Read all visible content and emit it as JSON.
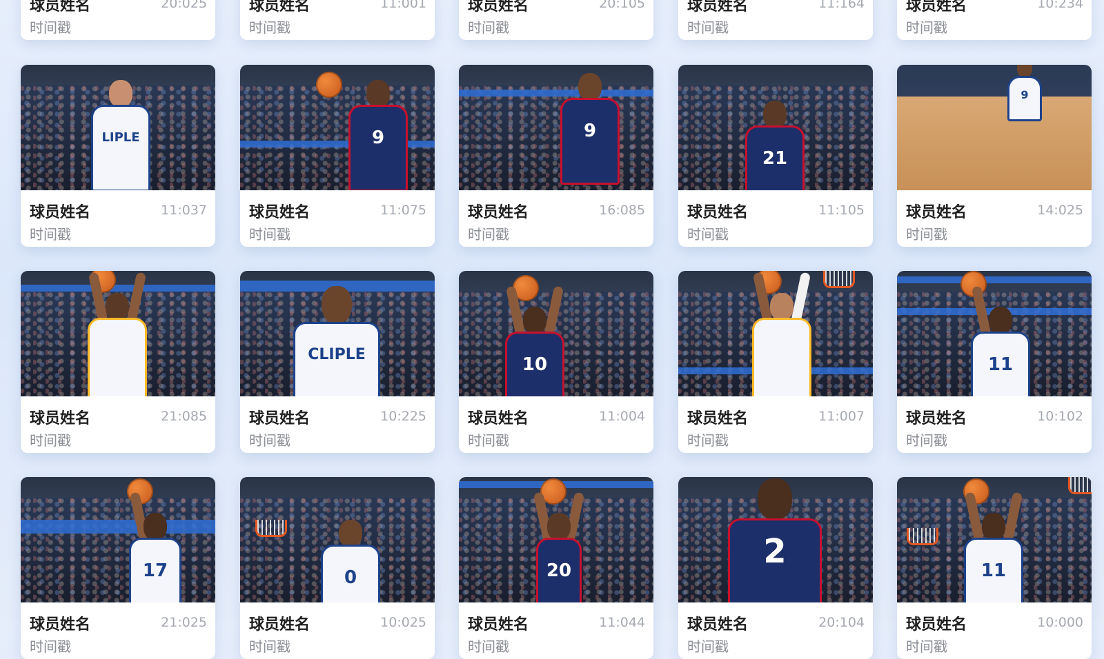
{
  "cards": [
    {
      "name": "球员姓名",
      "time": "20:025",
      "sub": "时间戳"
    },
    {
      "name": "球员姓名",
      "time": "11:001",
      "sub": "时间戳"
    },
    {
      "name": "球员姓名",
      "time": "20:105",
      "sub": "时间戳"
    },
    {
      "name": "球员姓名",
      "time": "11:164",
      "sub": "时间戳"
    },
    {
      "name": "球员姓名",
      "time": "10:234",
      "sub": "时间戳"
    },
    {
      "name": "球员姓名",
      "time": "11:037",
      "sub": "时间戳",
      "jersey": "LIPLE"
    },
    {
      "name": "球员姓名",
      "time": "11:075",
      "sub": "时间戳",
      "jersey": "9"
    },
    {
      "name": "球员姓名",
      "time": "16:085",
      "sub": "时间戳",
      "jersey": "9"
    },
    {
      "name": "球员姓名",
      "time": "11:105",
      "sub": "时间戳",
      "jersey": "21"
    },
    {
      "name": "球员姓名",
      "time": "14:025",
      "sub": "时间戳",
      "jersey": "9"
    },
    {
      "name": "球员姓名",
      "time": "21:085",
      "sub": "时间戳",
      "jersey": ""
    },
    {
      "name": "球员姓名",
      "time": "10:225",
      "sub": "时间戳",
      "jersey": "CLIPLE"
    },
    {
      "name": "球员姓名",
      "time": "11:004",
      "sub": "时间戳",
      "jersey": "10"
    },
    {
      "name": "球员姓名",
      "time": "11:007",
      "sub": "时间戳",
      "jersey": ""
    },
    {
      "name": "球员姓名",
      "time": "10:102",
      "sub": "时间戳",
      "jersey": "11"
    },
    {
      "name": "球员姓名",
      "time": "21:025",
      "sub": "时间戳",
      "jersey": "17"
    },
    {
      "name": "球员姓名",
      "time": "10:025",
      "sub": "时间戳",
      "jersey": "0"
    },
    {
      "name": "球员姓名",
      "time": "11:044",
      "sub": "时间戳",
      "jersey": "20"
    },
    {
      "name": "球员姓名",
      "time": "20:104",
      "sub": "时间戳",
      "jersey": "2"
    },
    {
      "name": "球员姓名",
      "time": "10:000",
      "sub": "时间戳",
      "jersey": "11"
    }
  ],
  "colors": {
    "background": "#dfe9fa",
    "card": "#ffffff",
    "name_text": "#1f1f1f",
    "time_text": "#a5a9b0",
    "sub_text": "#8c8f96"
  }
}
